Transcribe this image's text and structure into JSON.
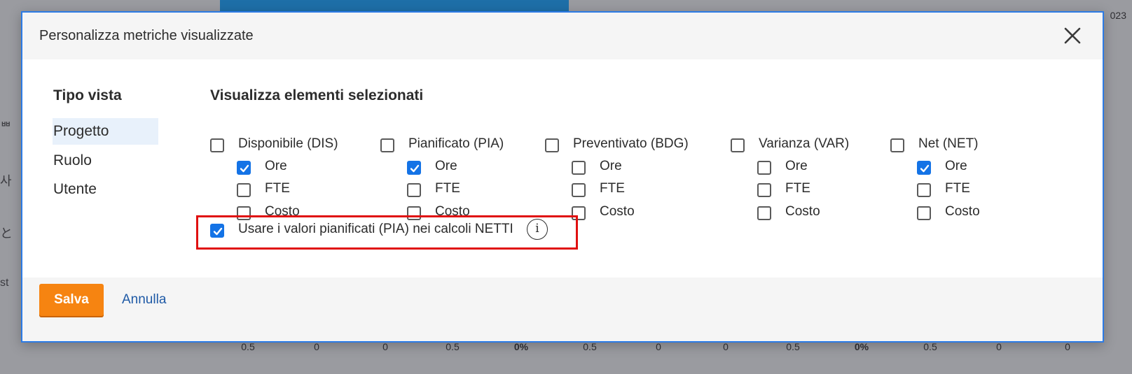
{
  "background": {
    "year_fragment": "023",
    "left_fragments": [
      "ᄈ",
      "사",
      "と",
      "st"
    ],
    "bottom_row": [
      "0.5",
      "0",
      "0",
      "0.5",
      "0%",
      "0.5",
      "0",
      "0",
      "0.5",
      "0%",
      "0.5",
      "0",
      "0"
    ]
  },
  "dialog": {
    "title": "Personalizza metriche visualizzate",
    "close_icon": "close-icon",
    "view_type": {
      "title": "Tipo vista",
      "items": [
        {
          "label": "Progetto",
          "selected": true
        },
        {
          "label": "Ruolo",
          "selected": false
        },
        {
          "label": "Utente",
          "selected": false
        }
      ]
    },
    "show_selected": {
      "title": "Visualizza elementi selezionati",
      "groups": [
        {
          "label": "Disponibile (DIS)",
          "checked": false,
          "options": [
            {
              "label": "Ore",
              "checked": true
            },
            {
              "label": "FTE",
              "checked": false
            },
            {
              "label": "Costo",
              "checked": false
            }
          ]
        },
        {
          "label": "Pianificato (PIA)",
          "checked": false,
          "options": [
            {
              "label": "Ore",
              "checked": true
            },
            {
              "label": "FTE",
              "checked": false
            },
            {
              "label": "Costo",
              "checked": false
            }
          ]
        },
        {
          "label": "Preventivato (BDG)",
          "checked": false,
          "options": [
            {
              "label": "Ore",
              "checked": false
            },
            {
              "label": "FTE",
              "checked": false
            },
            {
              "label": "Costo",
              "checked": false
            }
          ]
        },
        {
          "label": "Varianza (VAR)",
          "checked": false,
          "options": [
            {
              "label": "Ore",
              "checked": false
            },
            {
              "label": "FTE",
              "checked": false
            },
            {
              "label": "Costo",
              "checked": false
            }
          ]
        },
        {
          "label": "Net (NET)",
          "checked": false,
          "options": [
            {
              "label": "Ore",
              "checked": true
            },
            {
              "label": "FTE",
              "checked": false
            },
            {
              "label": "Costo",
              "checked": false
            }
          ]
        }
      ]
    },
    "use_planned": {
      "label": "Usare i valori pianificati (PIA) nei calcoli NETTI",
      "checked": true,
      "info_icon": "info-icon",
      "info_glyph": "i"
    },
    "footer": {
      "save_label": "Salva",
      "cancel_label": "Annulla"
    }
  },
  "colors": {
    "accent_blue": "#1473e6",
    "save_orange": "#f68411",
    "highlight_red": "#e01010",
    "link_blue": "#1f5aa6"
  }
}
